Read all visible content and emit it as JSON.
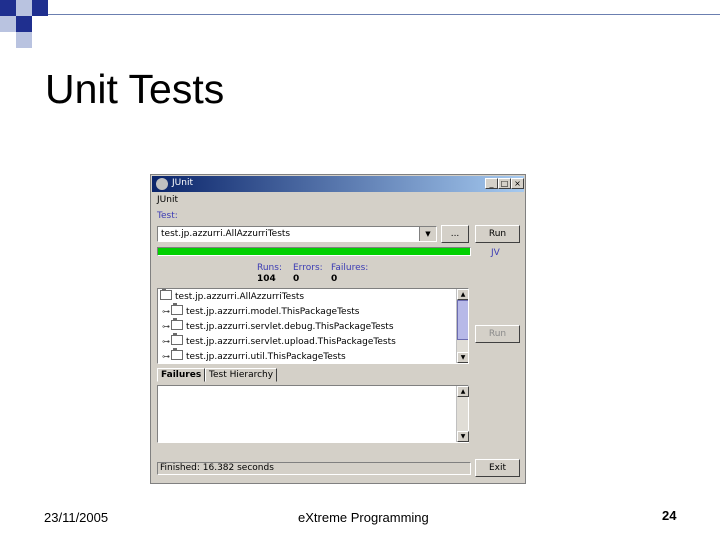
{
  "slide": {
    "title": "Unit Tests",
    "footer_date": "23/11/2005",
    "footer_center": "eXtreme Programming",
    "page_number": "24",
    "accent_colors": [
      "#1f2f8f",
      "#6b7fb0",
      "#b9c3e0"
    ]
  },
  "window": {
    "title": "JUnit",
    "controls": [
      "_",
      "□",
      "×"
    ],
    "menu": "JUnit",
    "test_label": "Test:",
    "test_value": "test.jp.azzurri.AllAzzurriTests",
    "browse_label": "...",
    "run_label": "Run",
    "progress_state": "success",
    "progress_fraction": 1.0,
    "logo": "JV",
    "stats": {
      "runs_label": "Runs:",
      "runs_value": "104",
      "errors_label": "Errors:",
      "errors_value": "0",
      "failures_label": "Failures:",
      "failures_value": "0"
    },
    "tree_items": [
      "test.jp.azzurri.AllAzzurriTests",
      "test.jp.azzurri.model.ThisPackageTests",
      "test.jp.azzurri.servlet.debug.ThisPackageTests",
      "test.jp.azzurri.servlet.upload.ThisPackageTests",
      "test.jp.azzurri.util.ThisPackageTests"
    ],
    "rerun_label": "Run",
    "tabs": [
      "Failures",
      "Test Hierarchy"
    ],
    "status_text": "Finished: 16.382 seconds",
    "exit_label": "Exit"
  }
}
